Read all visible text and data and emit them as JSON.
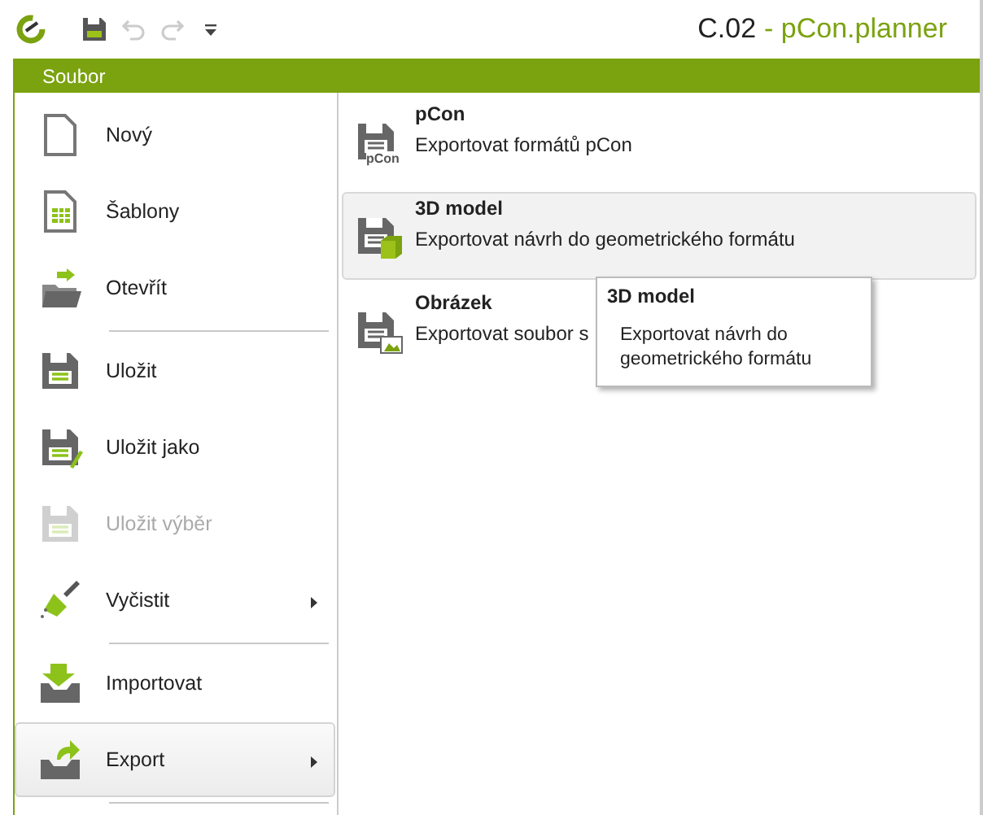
{
  "title_bar": {
    "document": "C.02",
    "app": "- pCon.planner",
    "quick_access": [
      {
        "kind": "save",
        "disabled": false
      },
      {
        "kind": "undo",
        "disabled": true
      },
      {
        "kind": "redo",
        "disabled": true
      },
      {
        "kind": "customize",
        "disabled": false
      }
    ]
  },
  "ribbon": {
    "tab": "Soubor"
  },
  "menu": [
    {
      "kind": "item",
      "label": "Nový",
      "disabled": false,
      "selected": false,
      "submenu": false
    },
    {
      "kind": "item",
      "label": "Šablony",
      "disabled": false,
      "selected": false,
      "submenu": false
    },
    {
      "kind": "item",
      "label": "Otevřít",
      "disabled": false,
      "selected": false,
      "submenu": false
    },
    {
      "kind": "separator"
    },
    {
      "kind": "item",
      "label": "Uložit",
      "disabled": false,
      "selected": false,
      "submenu": false
    },
    {
      "kind": "item",
      "label": "Uložit jako",
      "disabled": false,
      "selected": false,
      "submenu": false
    },
    {
      "kind": "item",
      "label": "Uložit výběr",
      "disabled": true,
      "selected": false,
      "submenu": false
    },
    {
      "kind": "item",
      "label": "Vyčistit",
      "disabled": false,
      "selected": false,
      "submenu": true
    },
    {
      "kind": "separator"
    },
    {
      "kind": "item",
      "label": "Importovat",
      "disabled": false,
      "selected": false,
      "submenu": false
    },
    {
      "kind": "item",
      "label": "Export",
      "disabled": false,
      "selected": true,
      "submenu": true
    },
    {
      "kind": "separator"
    }
  ],
  "export_options": [
    {
      "title": "pCon",
      "description": "Exportovat formátů pCon",
      "icon_label": "pCon",
      "hovered": false
    },
    {
      "title": "3D model",
      "description": "Exportovat návrh do geometrického formátu",
      "hovered": true
    },
    {
      "title": "Obrázek",
      "description": "Exportovat soubor s",
      "hovered": false
    }
  ],
  "tooltip": {
    "title": "3D model",
    "text": "Exportovat návrh do geometrického formátu"
  }
}
